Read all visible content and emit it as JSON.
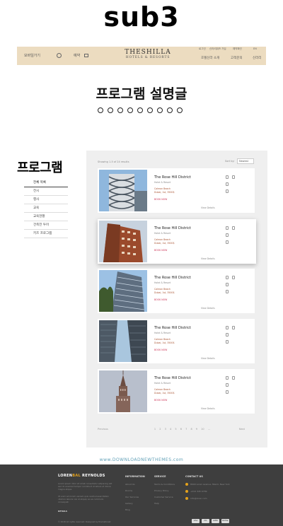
{
  "title": "sub3",
  "header": {
    "lang": "모바일가기",
    "reservation": "예약",
    "logo_line1": "THESHILLA",
    "logo_line2": "HOTELS & RESORTS",
    "util": [
      "로그인",
      "신라리워즈 가입",
      "예약확인",
      "EN"
    ],
    "nav": [
      "호텔신라 소개",
      "고객문의",
      "신라리"
    ]
  },
  "section_title": "프로그램 설명글",
  "program_label": "프로그램",
  "sidebar": {
    "items": [
      "전체 목록",
      "전시",
      "행사",
      "교육",
      "교육현황",
      "건축전 투어",
      "키즈 프로그램"
    ]
  },
  "content": {
    "topbar_left": "Showing 1-5 of 24 results",
    "topbar_right": "Sort by:",
    "sort_value": "Newest"
  },
  "cards": [
    {
      "name": "The Rose Hill District",
      "sub": "Hotel & Resort",
      "line1": "Calmon Beach",
      "line2": "Dubai, 1st, 3500$",
      "book": "BOOK NOW",
      "more": "View Details"
    },
    {
      "name": "The Rose Hill District",
      "sub": "Hotel & Resort",
      "line1": "Calmon Beach",
      "line2": "Dubai, 1st, 3500$",
      "book": "BOOK NOW",
      "more": "View Details"
    },
    {
      "name": "The Rose Hill District",
      "sub": "Hotel & Resort",
      "line1": "Calmon Beach",
      "line2": "Dubai, 1st, 3500$",
      "book": "BOOK NOW",
      "more": "View Details"
    },
    {
      "name": "The Rose Hill District",
      "sub": "Hotel & Resort",
      "line1": "Calmon Beach",
      "line2": "Dubai, 1st, 3500$",
      "book": "BOOK NOW",
      "more": "View Details"
    },
    {
      "name": "The Rose Hill District",
      "sub": "Hotel & Resort",
      "line1": "Calmon Beach",
      "line2": "Dubai, 1st, 3500$",
      "book": "BOOK NOW",
      "more": "View Details"
    }
  ],
  "pager": {
    "prev": "Previous",
    "pages": [
      "1",
      "2",
      "3",
      "4",
      "5",
      "6",
      "7",
      "8",
      "9",
      "10",
      "..."
    ],
    "next": "Next"
  },
  "watermark": "www.DOWNLOADNEWTHEMES.com",
  "footer": {
    "brand_a": "LOREN",
    "brand_b": "BAL",
    "brand_c": "REYNOLDS",
    "para1": "Lorem ipsum dolor sit amet consectetur adipiscing elit sed do eiusmod tempor incididunt ut labore et dolore magna aliqua.",
    "para2": "Ut enim ad minim veniam quis nostrud exercitation ullamco laboris nisi ut aliquip ex ea commodo consequat.",
    "details": "DETAILS",
    "col1_head": "INFORMATION",
    "col1": [
      "About Us",
      "Rooms",
      "Our Services",
      "Gallery",
      "Blog"
    ],
    "col2_head": "SERVICE",
    "col2": [
      "Terms & Conditions",
      "Privacy Policy",
      "Customer Service",
      "Help"
    ],
    "col3_head": "CONTACT US",
    "col3": [
      "8900 Loren Avenue, Miami, New York",
      "+012 345 6789",
      "info@loren.com"
    ],
    "copyright": "© 2018 All rights reserved. Designed by themeforest",
    "payments": [
      "VISA",
      "MC",
      "AMEX",
      "PAYPAL"
    ]
  }
}
